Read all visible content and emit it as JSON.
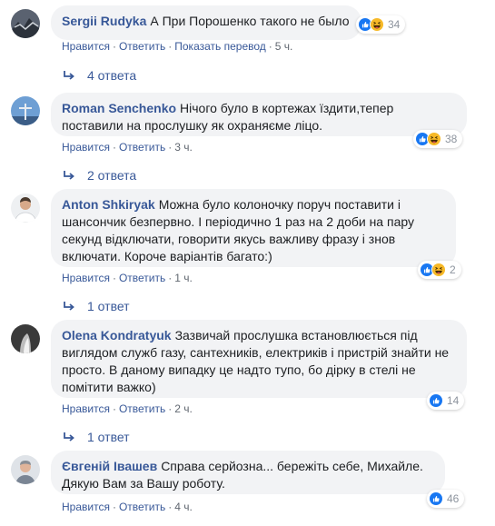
{
  "comments": [
    {
      "author": "Sergii Rudyka",
      "text": "А При Порошенко такого не было",
      "reaction_count": "34",
      "actions": {
        "like": "Нравится",
        "reply": "Ответить",
        "translate": "Показать перевод",
        "time": "5 ч."
      },
      "replies": "4 ответа"
    },
    {
      "author": "Roman Senchenko",
      "text": "Нічого було в кортежах їздити,тепер поставили на прослушку як охраняєме ліцо.",
      "reaction_count": "38",
      "actions": {
        "like": "Нравится",
        "reply": "Ответить",
        "time": "3 ч."
      },
      "replies": "2 ответа"
    },
    {
      "author": "Anton Shkiryak",
      "text": "Можна було колоночку поруч поставити і шансончик безпервно. І періодично 1 раз на 2 доби на пару секунд відключати, говорити якусь важливу фразу і знов включати. Короче варіантів багато:)",
      "reaction_count": "2",
      "actions": {
        "like": "Нравится",
        "reply": "Ответить",
        "time": "1 ч."
      },
      "replies": "1 ответ"
    },
    {
      "author": "Olena Kondratyuk",
      "text": "Зазвичай прослушка встановлюється під виглядом служб газу, сантехників, електриків і пристрій знайти не просто. В даному випадку це надто тупо, бо дірку в стелі не помітити важко)",
      "reaction_count": "14",
      "actions": {
        "like": "Нравится",
        "reply": "Ответить",
        "time": "2 ч."
      },
      "replies": "1 ответ"
    },
    {
      "author": "Євгеній Івашев",
      "text": "Справа серйозна... бережіть себе, Михайле. Дякую Вам за Вашу роботу.",
      "reaction_count": "46",
      "actions": {
        "like": "Нравится",
        "reply": "Ответить",
        "time": "4 ч."
      }
    }
  ],
  "colors": {
    "link": "#385898",
    "bubble": "#f2f3f5",
    "meta": "#606770",
    "like_blue": "#1877f2",
    "haha_yellow": "#f7b928"
  },
  "icons": [
    "like-reaction-icon",
    "haha-reaction-icon",
    "reply-arrow-icon"
  ]
}
